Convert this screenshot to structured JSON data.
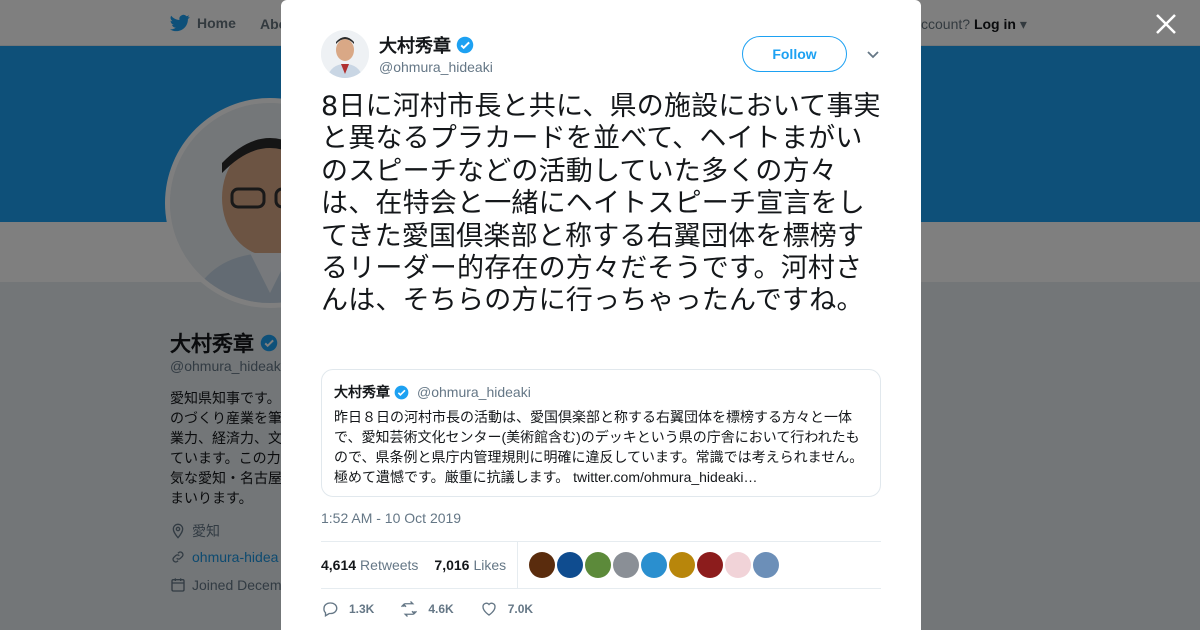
{
  "nav": {
    "home_label": "Home",
    "about_label": "Abo",
    "account_prompt": "ccount?",
    "login_label": "Log in"
  },
  "profile": {
    "name": "大村秀章",
    "handle": "@ohmura_hideak",
    "bio": "愛知県知事です。のづくり産業を筆業力、経済力、文ています。この力気な愛知・名古屋まいります。",
    "location": "愛知",
    "website": "ohmura-hidea",
    "joined": "Joined Decem"
  },
  "tweet": {
    "author_name": "大村秀章",
    "author_handle": "@ohmura_hideaki",
    "follow_label": "Follow",
    "text": "8日に河村市長と共に、県の施設において事実と異なるプラカードを並べて、ヘイトまがいのスピーチなどの活動していた多くの方々は、在特会と一緒にヘイトスピーチ宣言をしてきた愛国倶楽部と称する右翼団体を標榜するリーダー的存在の方々だそうです。河村さんは、そちらの方に行っちゃったんですね。",
    "quote": {
      "name": "大村秀章",
      "handle": "@ohmura_hideaki",
      "text": "昨日８日の河村市長の活動は、愛国倶楽部と称する右翼団体を標榜する方々と一体で、愛知芸術文化センター(美術館含む)のデッキという県の庁舎において行われたもので、県条例と県庁内管理規則に明確に違反しています。常識では考えられません。極めて遺憾です。厳重に抗議します。",
      "link": "twitter.com/ohmura_hideaki…"
    },
    "timestamp": "1:52 AM - 10 Oct 2019",
    "retweets_count": "4,614",
    "retweets_label": "Retweets",
    "likes_count": "7,016",
    "likes_label": "Likes",
    "reply_count": "1.3K",
    "retweet_action_count": "4.6K",
    "like_action_count": "7.0K"
  },
  "colors": {
    "brand": "#1da1f2",
    "verified": "#1da1f2",
    "muted": "#657786",
    "text": "#14171a"
  },
  "icons": [
    "twitter-bird-icon",
    "close-icon",
    "verified-badge-icon",
    "chevron-down-icon",
    "location-icon",
    "link-icon",
    "calendar-icon",
    "reply-icon",
    "retweet-icon",
    "like-icon"
  ],
  "liker_avatars": [
    "#5a2c0d",
    "#0f4c8f",
    "#5c8a3a",
    "#8a8f96",
    "#2a8fcf",
    "#b8860b",
    "#8c1c1c",
    "#f1d3d8",
    "#6c8fb8"
  ]
}
